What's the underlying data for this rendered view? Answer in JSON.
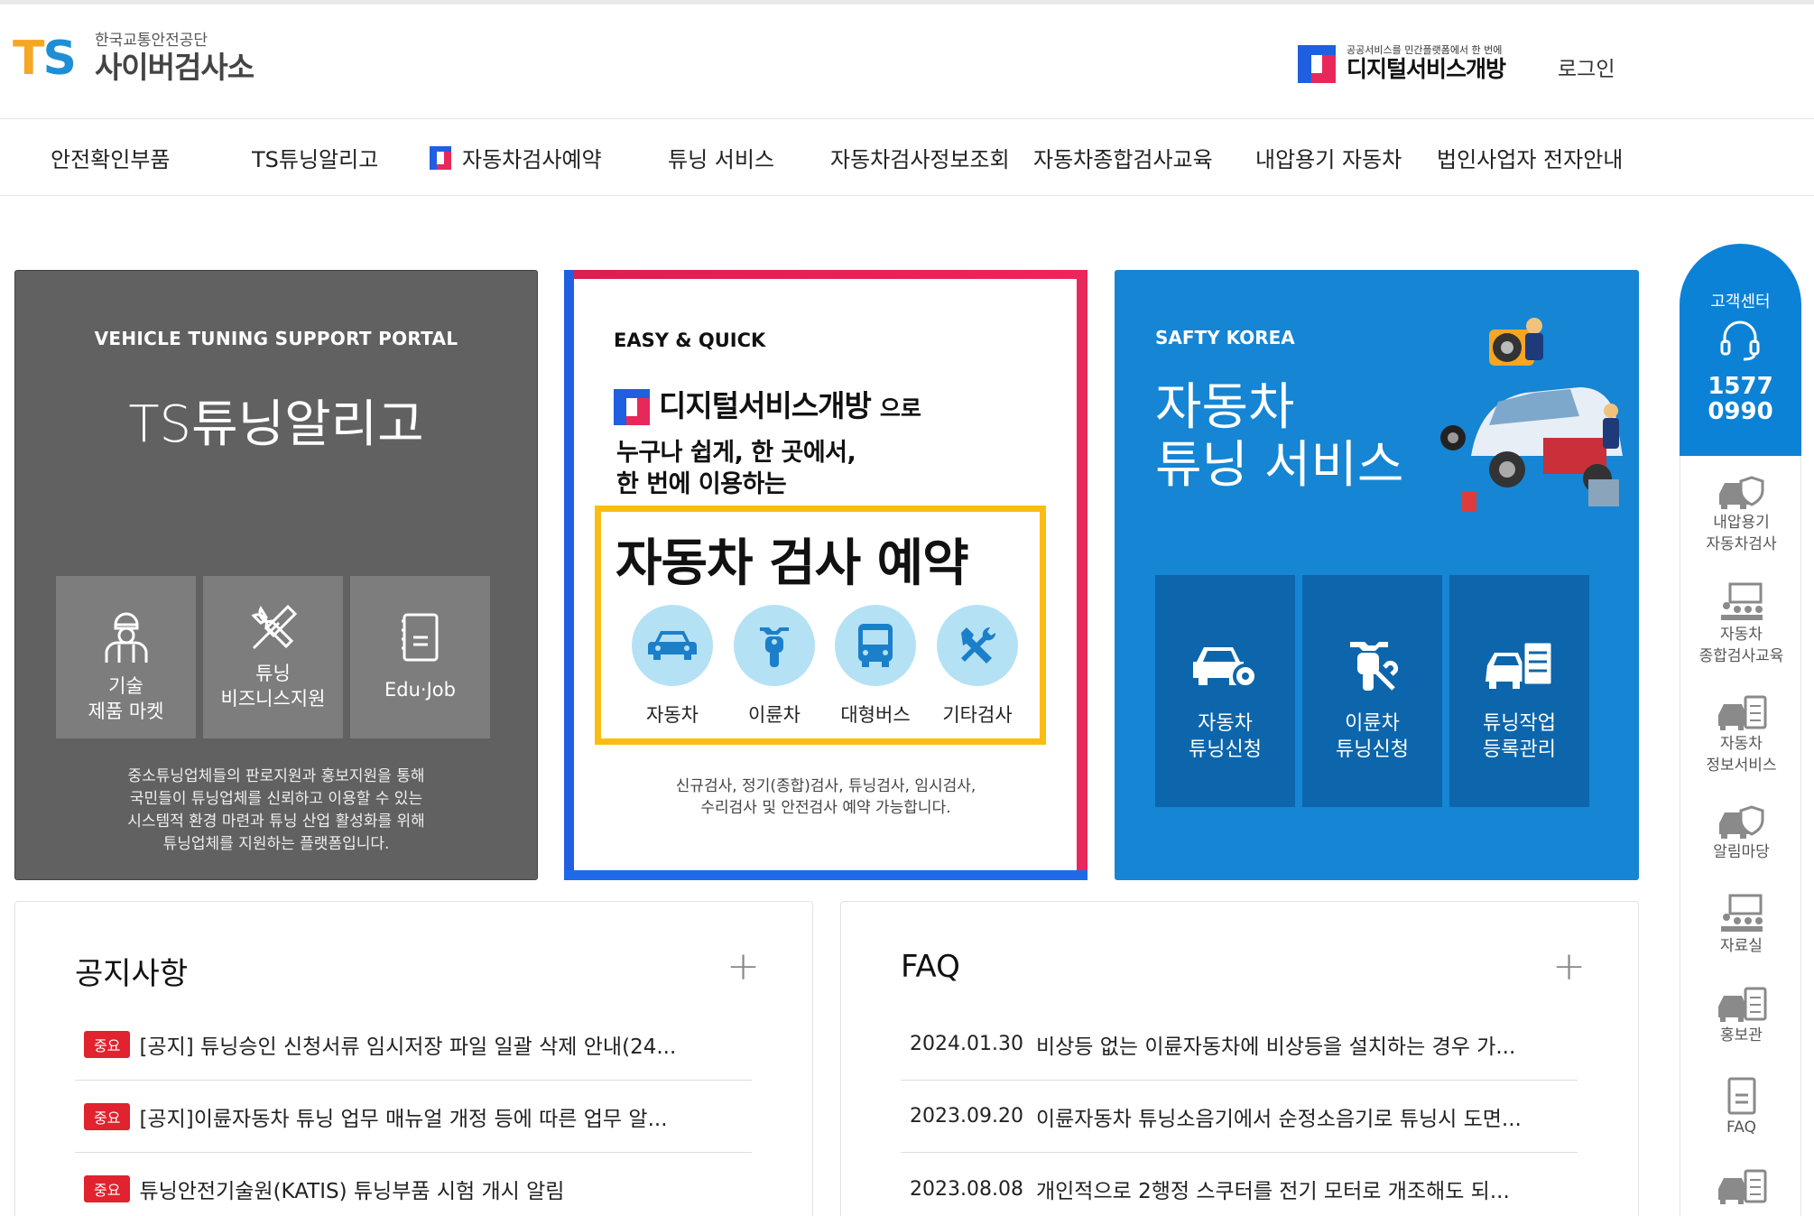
{
  "header": {
    "logo_mark": "TS",
    "logo_sub": "한국교통안전공단",
    "logo_title": "사이버검사소",
    "dsb_small": "공공서비스를 민간플랫폼에서 한 번에",
    "dsb_big": "디지털서비스개방",
    "login": "로그인"
  },
  "nav": {
    "items": [
      {
        "label": "안전확인부품"
      },
      {
        "label": "TS튜닝알리고"
      },
      {
        "label": "자동차검사예약"
      },
      {
        "label": "튜닝 서비스"
      },
      {
        "label": "자동차검사정보조회"
      },
      {
        "label": "자동차종합검사교육"
      },
      {
        "label": "내압용기 자동차"
      },
      {
        "label": "법인사업자 전자안내"
      }
    ]
  },
  "card_tuning_portal": {
    "eyebrow": "VEHICLE TUNING SUPPORT PORTAL",
    "title": "TS튜닝알리고",
    "tiles": [
      {
        "line1": "기술",
        "line2": "제품 마켓",
        "icon": "mechanic-icon"
      },
      {
        "line1": "튜닝",
        "line2": "비즈니스지원",
        "icon": "tools-icon"
      },
      {
        "line1": "Edu·Job",
        "line2": "",
        "icon": "document-icon"
      }
    ],
    "desc_lines": [
      "중소튜닝업체들의 판로지원과 홍보지원을 통해",
      "국민들이 튜닝업체를 신뢰하고 이용할 수 있는",
      "시스템적 환경 마련과 튜닝 산업 활성화를 위해",
      "튜닝업체를 지원하는 플랫폼입니다."
    ]
  },
  "card_reservation": {
    "eyebrow": "EASY & QUICK",
    "dsb": "디지털서비스개방",
    "dsb_suffix": "으로",
    "line1": "누구나 쉽게, 한 곳에서,",
    "line2": "한 번에 이용하는",
    "headline": "자동차 검사 예약",
    "categories": [
      {
        "label": "자동차",
        "icon": "car-icon"
      },
      {
        "label": "이륜차",
        "icon": "motorcycle-icon"
      },
      {
        "label": "대형버스",
        "icon": "bus-icon"
      },
      {
        "label": "기타검사",
        "icon": "tools-icon"
      }
    ],
    "desc_line1": "신규검사, 정기(종합)검사, 튜닝검사, 임시검사,",
    "desc_line2": "수리검사 및 안전검사 예약 가능합니다."
  },
  "card_tuning_service": {
    "eyebrow": "SAFTY KOREA",
    "title_line1": "자동차",
    "title_line2": "튜닝 서비스",
    "tiles": [
      {
        "line1": "자동차",
        "line2": "튜닝신청",
        "icon": "car-gear-icon"
      },
      {
        "line1": "이륜차",
        "line2": "튜닝신청",
        "icon": "scooter-wrench-icon"
      },
      {
        "line1": "튜닝작업",
        "line2": "등록관리",
        "icon": "car-checklist-icon"
      }
    ]
  },
  "notices": {
    "title": "공지사항",
    "more": "+",
    "items": [
      {
        "badge": "중요",
        "text": "[공지] 튜닝승인 신청서류 임시저장 파일 일괄 삭제 안내(24..."
      },
      {
        "badge": "중요",
        "text": "[공지]이륜자동차 튜닝 업무 매뉴얼 개정 등에 따른 업무 알..."
      },
      {
        "badge": "중요",
        "text": "튜닝안전기술원(KATIS) 튜닝부품 시험 개시 알림"
      }
    ]
  },
  "faq": {
    "title": "FAQ",
    "more": "+",
    "items": [
      {
        "date": "2024.01.30",
        "text": "비상등 없는 이륜자동차에 비상등을 설치하는 경우 가..."
      },
      {
        "date": "2023.09.20",
        "text": "이륜자동차 튜닝소음기에서 순정소음기로 튜닝시 도면..."
      },
      {
        "date": "2023.08.08",
        "text": "개인적으로 2행정 스쿠터를 전기 모터로 개조해도 되..."
      }
    ]
  },
  "quick_menu": {
    "cs_label": "고객센터",
    "cs_phone1": "1577",
    "cs_phone2": "0990",
    "items": [
      {
        "line1": "내압용기",
        "line2": "자동차검사",
        "icon": "car-shield-icon"
      },
      {
        "line1": "자동차",
        "line2": "종합검사교육",
        "icon": "classroom-icon"
      },
      {
        "line1": "자동차",
        "line2": "정보서비스",
        "icon": "car-checklist-icon"
      },
      {
        "line1": "알림마당",
        "line2": "",
        "icon": "car-shield-icon"
      },
      {
        "line1": "자료실",
        "line2": "",
        "icon": "classroom-icon"
      },
      {
        "line1": "홍보관",
        "line2": "",
        "icon": "car-checklist-icon"
      },
      {
        "line1": "FAQ",
        "line2": "",
        "icon": "document-icon"
      }
    ]
  },
  "colors": {
    "accent_blue": "#1585d4",
    "card_gray": "#616161",
    "highlight_yellow": "#fbbd14",
    "badge_red": "#e0232e"
  }
}
